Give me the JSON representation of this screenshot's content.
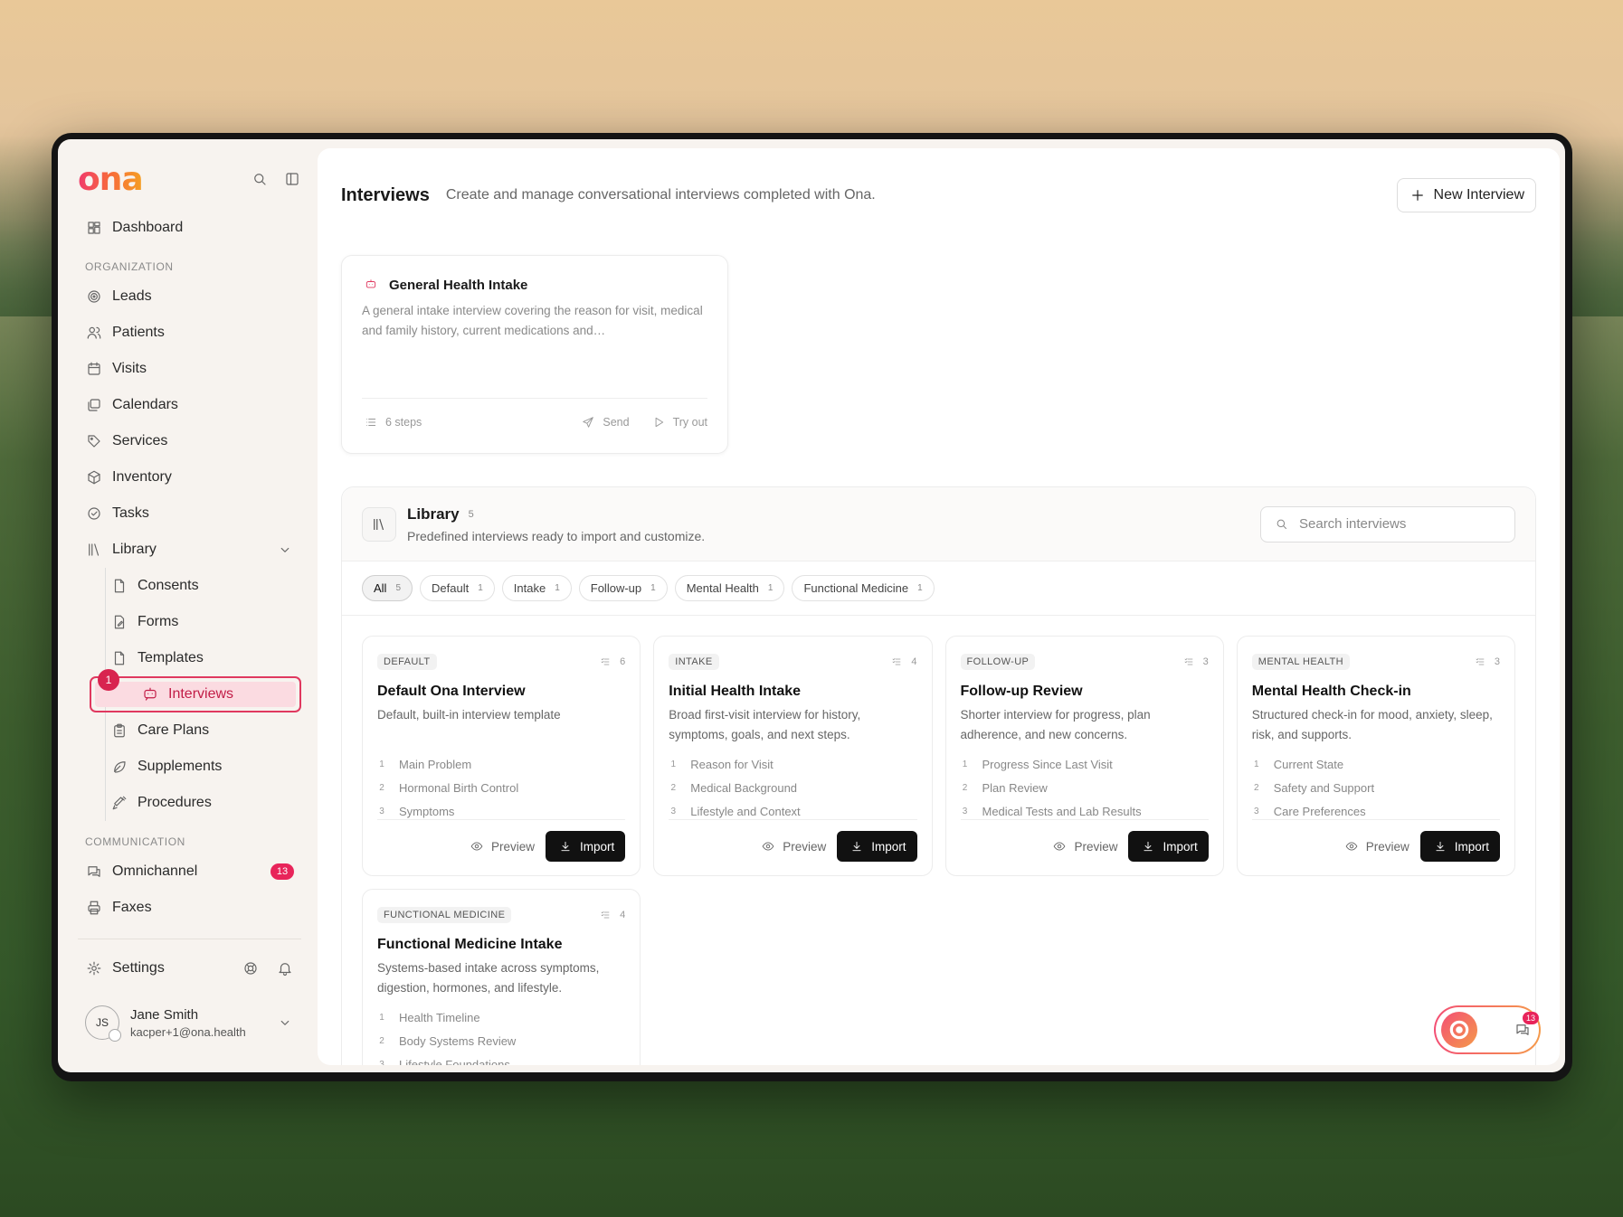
{
  "brand": {
    "logo": "ona"
  },
  "sidebar": {
    "dashboard": "Dashboard",
    "org_section": "ORGANIZATION",
    "org_items": [
      {
        "label": "Leads",
        "icon": "target-icon"
      },
      {
        "label": "Patients",
        "icon": "users-icon"
      },
      {
        "label": "Visits",
        "icon": "calendar-icon"
      },
      {
        "label": "Calendars",
        "icon": "calendars-icon"
      },
      {
        "label": "Services",
        "icon": "tag-icon"
      },
      {
        "label": "Inventory",
        "icon": "box-icon"
      },
      {
        "label": "Tasks",
        "icon": "check-circle-icon"
      },
      {
        "label": "Library",
        "icon": "library-icon"
      }
    ],
    "library_items": [
      {
        "label": "Consents"
      },
      {
        "label": "Forms"
      },
      {
        "label": "Templates"
      },
      {
        "label": "Interviews",
        "active": true,
        "marker": "1"
      },
      {
        "label": "Care Plans"
      },
      {
        "label": "Supplements"
      },
      {
        "label": "Procedures"
      }
    ],
    "comm_section": "COMMUNICATION",
    "omnichannel": "Omnichannel",
    "omnichannel_count": "13",
    "faxes": "Faxes",
    "settings": "Settings",
    "user": {
      "initials": "JS",
      "name": "Jane Smith",
      "email": "kacper+1@ona.health"
    }
  },
  "header": {
    "title": "Interviews",
    "subtitle": "Create and manage conversational interviews completed with Ona.",
    "new_button": "New Interview"
  },
  "my_interview": {
    "title": "General Health Intake",
    "description": "A general intake interview covering the reason for visit, medical and family history, current medications and…",
    "steps": "6 steps",
    "send": "Send",
    "try": "Try out"
  },
  "library": {
    "title": "Library",
    "count": "5",
    "subtitle": "Predefined interviews ready to import and customize.",
    "search_placeholder": "Search interviews",
    "tabs": [
      {
        "label": "All",
        "count": "5",
        "active": true
      },
      {
        "label": "Default",
        "count": "1"
      },
      {
        "label": "Intake",
        "count": "1"
      },
      {
        "label": "Follow-up",
        "count": "1"
      },
      {
        "label": "Mental Health",
        "count": "1"
      },
      {
        "label": "Functional Medicine",
        "count": "1"
      }
    ],
    "preview_label": "Preview",
    "import_label": "Import",
    "cards": [
      {
        "tag": "DEFAULT",
        "steps": "6",
        "title": "Default Ona Interview",
        "desc": "Default, built-in interview template",
        "items": [
          "Main Problem",
          "Hormonal Birth Control",
          "Symptoms"
        ]
      },
      {
        "tag": "INTAKE",
        "steps": "4",
        "title": "Initial Health Intake",
        "desc": "Broad first-visit interview for history, symptoms, goals, and next steps.",
        "items": [
          "Reason for Visit",
          "Medical Background",
          "Lifestyle and Context"
        ]
      },
      {
        "tag": "FOLLOW-UP",
        "steps": "3",
        "title": "Follow-up Review",
        "desc": "Shorter interview for progress, plan adherence, and new concerns.",
        "items": [
          "Progress Since Last Visit",
          "Plan Review",
          "Medical Tests and Lab Results"
        ]
      },
      {
        "tag": "MENTAL HEALTH",
        "steps": "3",
        "title": "Mental Health Check-in",
        "desc": "Structured check-in for mood, anxiety, sleep, risk, and supports.",
        "items": [
          "Current State",
          "Safety and Support",
          "Care Preferences"
        ]
      },
      {
        "tag": "FUNCTIONAL MEDICINE",
        "steps": "4",
        "title": "Functional Medicine Intake",
        "desc": "Systems-based intake across symptoms, digestion, hormones, and lifestyle.",
        "items": [
          "Health Timeline",
          "Body Systems Review",
          "Lifestyle Foundations"
        ]
      }
    ]
  },
  "chat_widget": {
    "count": "13"
  }
}
